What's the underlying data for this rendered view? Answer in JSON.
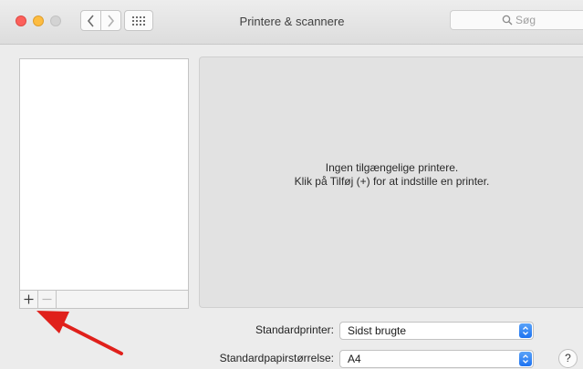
{
  "window": {
    "title": "Printere & scannere",
    "search_placeholder": "Søg"
  },
  "sidebar": {
    "add_label": "+",
    "remove_label": "−"
  },
  "info": {
    "line1": "Ingen tilgængelige printere.",
    "line2": "Klik på Tilføj (+) for at indstille en printer."
  },
  "settings": {
    "default_printer_label": "Standardprinter:",
    "default_printer_value": "Sidst brugte",
    "default_paper_label": "Standardpapirstørrelse:",
    "default_paper_value": "A4"
  },
  "help": {
    "label": "?"
  },
  "colors": {
    "accent": "#1d72f1",
    "annotation_arrow": "#e0201b"
  }
}
